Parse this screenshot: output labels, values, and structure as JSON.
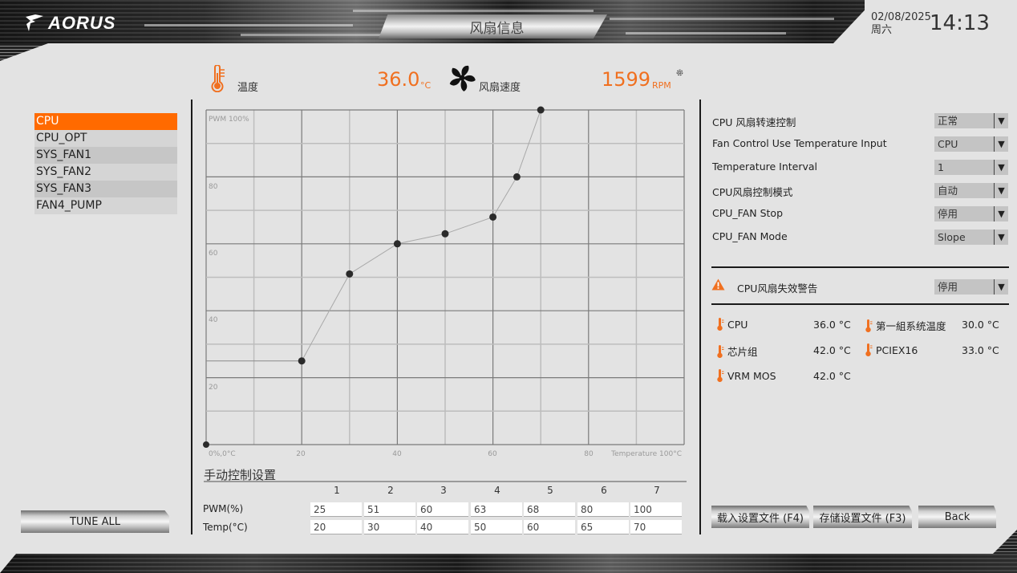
{
  "header": {
    "logo": "AORUS",
    "title": "风扇信息",
    "date": "02/08/2025",
    "weekday": "周六",
    "time": "14:13"
  },
  "readouts": {
    "temp_label": "温度",
    "temp_value": "36.0",
    "temp_unit": "°C",
    "fan_label": "风扇速度",
    "fan_value": "1599",
    "fan_unit": "RPM"
  },
  "fans": [
    {
      "label": "CPU",
      "active": true
    },
    {
      "label": "CPU_OPT",
      "active": false
    },
    {
      "label": "SYS_FAN1",
      "active": false
    },
    {
      "label": "SYS_FAN2",
      "active": false
    },
    {
      "label": "SYS_FAN3",
      "active": false
    },
    {
      "label": "FAN4_PUMP",
      "active": false
    }
  ],
  "buttons": {
    "tune_all": "TUNE ALL",
    "load_profile": "载入设置文件 (F4)",
    "save_profile": "存储设置文件 (F3)",
    "back": "Back"
  },
  "chart_data": {
    "type": "line",
    "title": "",
    "xlabel": "Temperature 100°C",
    "ylabel": "PWM 100%",
    "origin_label": "0%,0°C",
    "xlim": [
      0,
      100
    ],
    "ylim": [
      0,
      100
    ],
    "x_ticks": [
      "20",
      "40",
      "60",
      "80"
    ],
    "y_ticks": [
      "80",
      "60",
      "40",
      "20"
    ],
    "grid": true,
    "series": [
      {
        "name": "CPU fan curve",
        "points": [
          {
            "x": 0,
            "y": 0,
            "label": "0"
          },
          {
            "x": 20,
            "y": 25,
            "label": "1"
          },
          {
            "x": 30,
            "y": 51,
            "label": "2"
          },
          {
            "x": 40,
            "y": 60,
            "label": "3"
          },
          {
            "x": 50,
            "y": 63,
            "label": "4"
          },
          {
            "x": 60,
            "y": 68,
            "label": "5"
          },
          {
            "x": 65,
            "y": 80,
            "label": "6"
          },
          {
            "x": 70,
            "y": 100,
            "label": "7"
          }
        ]
      }
    ]
  },
  "manual": {
    "title": "手动控制设置",
    "columns": [
      "1",
      "2",
      "3",
      "4",
      "5",
      "6",
      "7"
    ],
    "pwm_label": "PWM(%)",
    "temp_label": "Temp(°C)",
    "pwm": [
      "25",
      "51",
      "60",
      "63",
      "68",
      "80",
      "100"
    ],
    "temp": [
      "20",
      "30",
      "40",
      "50",
      "60",
      "65",
      "70"
    ]
  },
  "settings": [
    {
      "label": "CPU 风扇转速控制",
      "value": "正常"
    },
    {
      "label": "Fan Control Use Temperature Input",
      "value": "CPU"
    },
    {
      "label": "Temperature Interval",
      "value": "1"
    },
    {
      "label": "CPU风扇控制模式",
      "value": "自动"
    },
    {
      "label": "CPU_FAN Stop",
      "value": "停用"
    },
    {
      "label": "CPU_FAN Mode",
      "value": "Slope"
    }
  ],
  "warning": {
    "label": "CPU风扇失效警告",
    "value": "停用"
  },
  "sensors": [
    {
      "label": "CPU",
      "value": "36.0 °C"
    },
    {
      "label": "第一組系统温度",
      "value": "30.0 °C"
    },
    {
      "label": "芯片组",
      "value": "42.0 °C"
    },
    {
      "label": "PCIEX16",
      "value": "33.0 °C"
    },
    {
      "label": "VRM MOS",
      "value": "42.0 °C"
    }
  ],
  "colors": {
    "accent": "#ff6a00",
    "readout": "#f07020",
    "background": "#e3e3e3"
  }
}
